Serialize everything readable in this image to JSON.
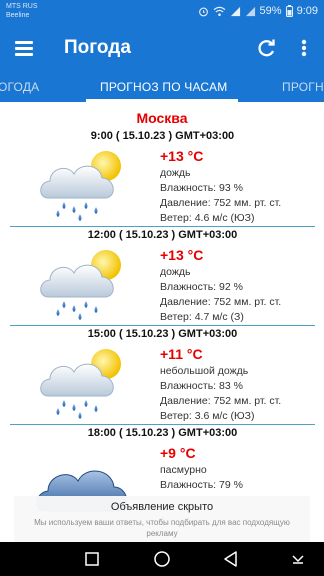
{
  "status_bar": {
    "carrier_1": "MTS RUS",
    "carrier_2": "Beeline",
    "battery": "59%",
    "time": "9:09"
  },
  "app_bar": {
    "title": "Погода",
    "menu_icon": "hamburger-icon",
    "refresh_icon": "refresh-icon",
    "more_icon": "more-vert-icon",
    "color": "#1976d2"
  },
  "tabs": [
    {
      "label": "ОГОДА"
    },
    {
      "label": "ПРОГНОЗ ПО ЧАСАМ"
    },
    {
      "label": "ПРОГН"
    }
  ],
  "forecast": {
    "city": "Москва",
    "entries": [
      {
        "time": "9:00 ( 15.10.23 ) GMT+03:00",
        "temp": "+13 °C",
        "condition": "дождь",
        "humidity": "Влажность: 93 %",
        "pressure": "Давление: 752 мм. рт. ст.",
        "wind": "Ветер: 4.6 м/с (ЮЗ)",
        "icon": "sun-cloud-rain-icon"
      },
      {
        "time": "12:00 ( 15.10.23 ) GMT+03:00",
        "temp": "+13 °C",
        "condition": "дождь",
        "humidity": "Влажность: 92 %",
        "pressure": "Давление: 752 мм. рт. ст.",
        "wind": "Ветер: 4.7 м/с (З)",
        "icon": "sun-cloud-rain-icon"
      },
      {
        "time": "15:00 ( 15.10.23 ) GMT+03:00",
        "temp": "+11 °C",
        "condition": "небольшой дождь",
        "humidity": "Влажность: 83 %",
        "pressure": "Давление: 752 мм. рт. ст.",
        "wind": "Ветер: 3.6 м/с (ЮЗ)",
        "icon": "sun-cloud-rain-icon"
      },
      {
        "time": "18:00 ( 15.10.23 ) GMT+03:00",
        "temp": "+9 °C",
        "condition": "пасмурно",
        "humidity": "Влажность: 79 %",
        "icon": "overcast-cloud-icon"
      }
    ]
  },
  "ad": {
    "title": "Объявление скрыто",
    "text": "Мы используем ваши ответы, чтобы подбирать для вас подходящую рекламу"
  },
  "nav_bar": {
    "back_icon": "back-triangle-icon",
    "home_icon": "home-circle-icon",
    "recents_icon": "recents-square-icon",
    "notifications_icon": "notifications-down-icon"
  }
}
